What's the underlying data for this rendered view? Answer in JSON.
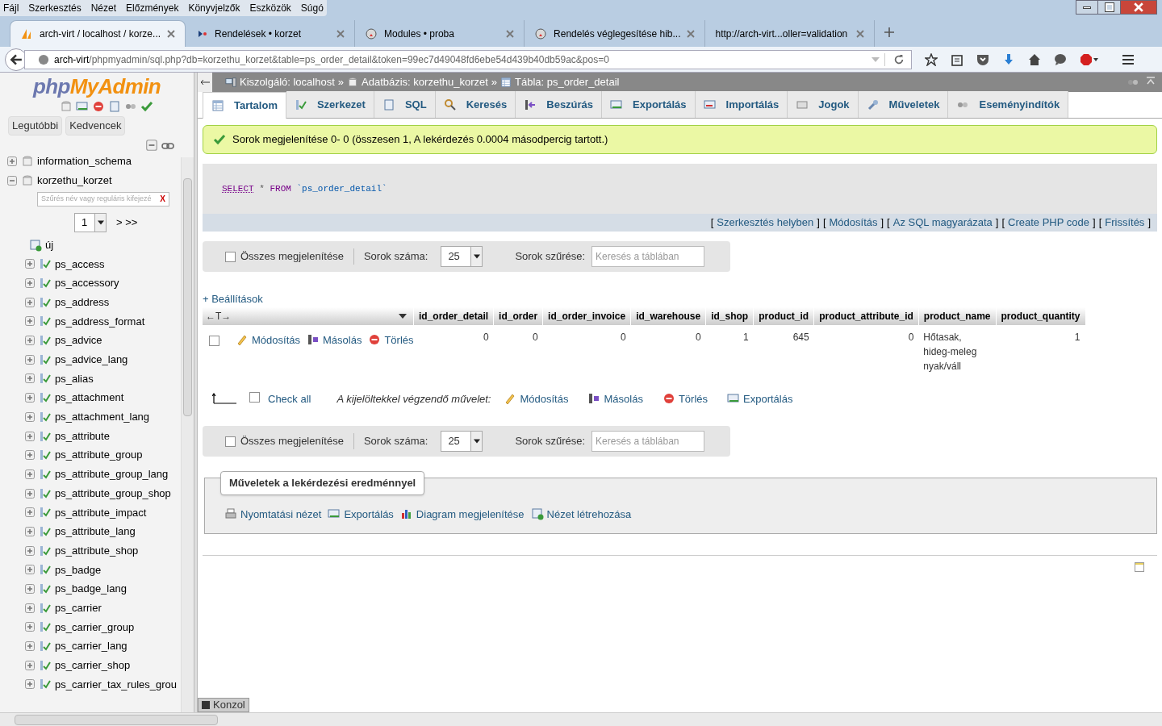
{
  "menu": [
    "Fájl",
    "Szerkesztés",
    "Nézet",
    "Előzmények",
    "Könyvjelzők",
    "Eszközök",
    "Súgó"
  ],
  "browser_tabs": [
    {
      "title": "arch-virt / localhost / korze...",
      "selected": true
    },
    {
      "title": "Rendelések • korzet",
      "selected": false
    },
    {
      "title": "Modules • proba",
      "selected": false
    },
    {
      "title": "Rendelés véglegesítése hib...",
      "selected": false
    },
    {
      "title": "http://arch-virt...oller=validation",
      "selected": false
    }
  ],
  "url": {
    "host": "arch-virt",
    "path": "/phpmyadmin/sql.php?db=korzethu_korzet&table=ps_order_detail&token=99ec7d49048fd6ebe54d439b40db59ac&pos=0"
  },
  "sidebar": {
    "logo_php": "php",
    "logo_rest": "MyAdmin",
    "buttons": [
      "Legutóbbi",
      "Kedvencek"
    ],
    "databases": [
      {
        "name": "information_schema",
        "expanded": false
      },
      {
        "name": "korzethu_korzet",
        "expanded": true
      }
    ],
    "filter_placeholder": "Szűrés név vagy reguláris kifejezé",
    "filter_clear": "X",
    "page": "1",
    "page_nav": "> >>",
    "new_item": "új",
    "tables": [
      "ps_access",
      "ps_accessory",
      "ps_address",
      "ps_address_format",
      "ps_advice",
      "ps_advice_lang",
      "ps_alias",
      "ps_attachment",
      "ps_attachment_lang",
      "ps_attribute",
      "ps_attribute_group",
      "ps_attribute_group_lang",
      "ps_attribute_group_shop",
      "ps_attribute_impact",
      "ps_attribute_lang",
      "ps_attribute_shop",
      "ps_badge",
      "ps_badge_lang",
      "ps_carrier",
      "ps_carrier_group",
      "ps_carrier_lang",
      "ps_carrier_shop",
      "ps_carrier_tax_rules_grou"
    ]
  },
  "breadcrumb": {
    "separator": "»",
    "items": [
      {
        "label": "Kiszolgáló: localhost",
        "kind": "server"
      },
      {
        "label": "Adatbázis: korzethu_korzet",
        "kind": "database"
      },
      {
        "label": "Tábla: ps_order_detail",
        "kind": "table"
      }
    ]
  },
  "tabs": [
    {
      "label": "Tartalom",
      "selected": true
    },
    {
      "label": "Szerkezet",
      "selected": false
    },
    {
      "label": "SQL",
      "selected": false
    },
    {
      "label": "Keresés",
      "selected": false
    },
    {
      "label": "Beszúrás",
      "selected": false
    },
    {
      "label": "Exportálás",
      "selected": false
    },
    {
      "label": "Importálás",
      "selected": false
    },
    {
      "label": "Jogok",
      "selected": false
    },
    {
      "label": "Műveletek",
      "selected": false
    },
    {
      "label": "Eseményindítók",
      "selected": false
    }
  ],
  "success_message": "Sorok megjelenítése 0- 0 (összesen 1, A lekérdezés 0.0004 másodpercig tartott.)",
  "query": {
    "keyword1": "SELECT",
    "star": "*",
    "keyword2": "FROM",
    "table": "`ps_order_detail`"
  },
  "query_links": {
    "open": "[",
    "close": "]",
    "links": [
      "Szerkesztés helyben",
      "Módosítás",
      "Az SQL magyarázata",
      "Create PHP code",
      "Frissítés"
    ]
  },
  "nav_controls": [
    {
      "show_all": "Összes megjelenítése",
      "checked": false,
      "rows_label": "Sorok száma:",
      "rows_value": "25",
      "filter_label": "Sorok szűrése:",
      "filter_placeholder": "Keresés a táblában"
    },
    {
      "show_all": "Összes megjelenítése",
      "checked": false,
      "rows_label": "Sorok száma:",
      "rows_value": "25",
      "filter_label": "Sorok szűrése:",
      "filter_placeholder": "Keresés a táblában"
    }
  ],
  "settings_link": "+ Beállítások",
  "table": {
    "arrows": "←T→",
    "columns": [
      "id_order_detail",
      "id_order",
      "id_order_invoice",
      "id_warehouse",
      "id_shop",
      "product_id",
      "product_attribute_id",
      "product_name",
      "product_quantity"
    ],
    "rows": [
      {
        "checked": false,
        "actions": [
          "Módosítás",
          "Másolás",
          "Törlés"
        ],
        "cells": [
          "0",
          "0",
          "0",
          "0",
          "1",
          "645",
          "0",
          "Hőtasak, hideg-meleg nyak/váll",
          "1"
        ]
      }
    ]
  },
  "bulk": {
    "check_all": "Check all",
    "checked": false,
    "label": "A kijelöltekkel végzendő művelet:",
    "actions": [
      "Módosítás",
      "Másolás",
      "Törlés",
      "Exportálás"
    ]
  },
  "query_ops": {
    "title": "Műveletek a lekérdezési eredménnyel",
    "links": [
      "Nyomtatási nézet",
      "Exportálás",
      "Diagram megjelenítése",
      "Nézet létrehozása"
    ]
  },
  "console": "Konzol"
}
